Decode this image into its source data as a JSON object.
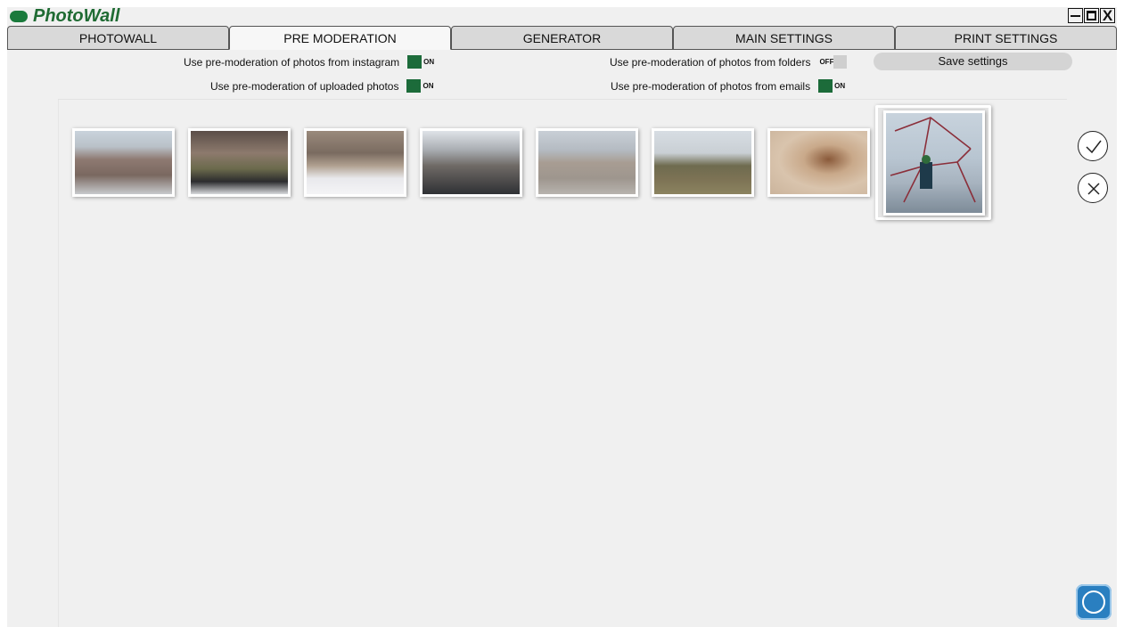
{
  "app": {
    "title": "PhotoWall",
    "window_controls": {
      "minimize": "minimize-icon",
      "maximize": "maximize-icon",
      "close": "X"
    }
  },
  "tabs": [
    {
      "label": "PHOTOWALL",
      "active": false
    },
    {
      "label": "PRE MODERATION",
      "active": true
    },
    {
      "label": "GENERATOR",
      "active": false
    },
    {
      "label": "MAIN SETTINGS",
      "active": false
    },
    {
      "label": "PRINT SETTINGS",
      "active": false
    }
  ],
  "settings": {
    "instagram": {
      "label": "Use pre-moderation of photos from instagram",
      "state": "ON"
    },
    "uploaded": {
      "label": "Use pre-moderation of uploaded photos",
      "state": "ON"
    },
    "folders": {
      "label": "Use pre-moderation of photos from folders",
      "state": "OFF"
    },
    "emails": {
      "label": "Use pre-moderation of photos from emails",
      "state": "ON"
    },
    "save_label": "Save settings"
  },
  "photos": [
    {
      "icon": "photo-thumbnail",
      "selected": false
    },
    {
      "icon": "photo-thumbnail",
      "selected": false
    },
    {
      "icon": "photo-thumbnail",
      "selected": false
    },
    {
      "icon": "photo-thumbnail",
      "selected": false
    },
    {
      "icon": "photo-thumbnail",
      "selected": false
    },
    {
      "icon": "photo-thumbnail",
      "selected": false
    },
    {
      "icon": "photo-thumbnail",
      "selected": false
    },
    {
      "icon": "photo-thumbnail",
      "selected": true
    }
  ],
  "actions": {
    "approve": "check-icon",
    "reject": "cross-icon"
  },
  "colors": {
    "accent": "#1c6b3a",
    "title": "#1f6b33",
    "logo": "#2a7fc0"
  }
}
